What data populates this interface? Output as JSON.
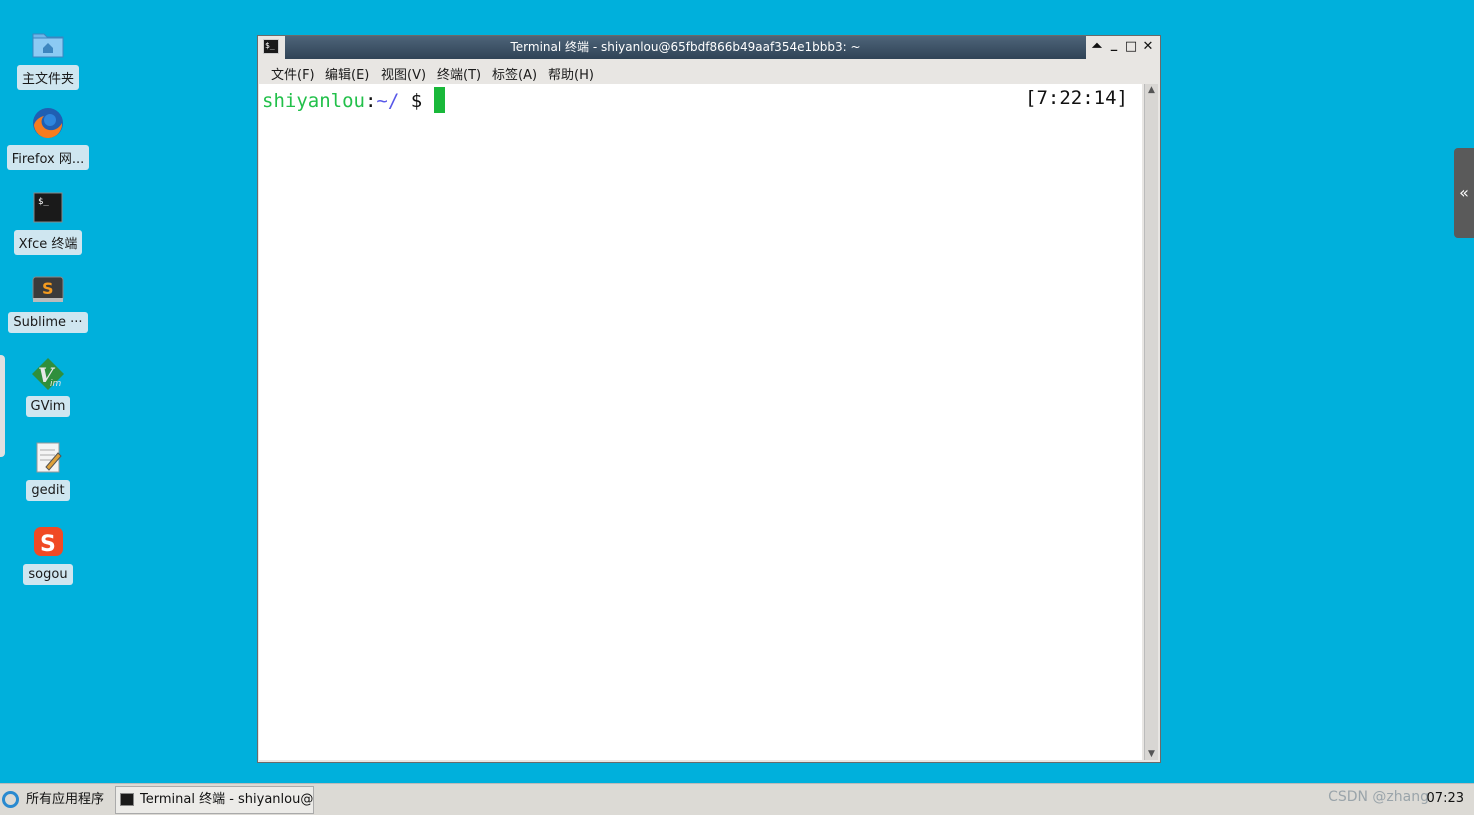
{
  "desktop": {
    "icons": [
      {
        "label": "主文件夹",
        "icon": "home-folder-icon"
      },
      {
        "label": "Firefox 网...",
        "icon": "firefox-icon"
      },
      {
        "label": "Xfce 终端",
        "icon": "terminal-icon"
      },
      {
        "label": "Sublime ···",
        "icon": "sublime-icon"
      },
      {
        "label": "GVim",
        "icon": "gvim-icon"
      },
      {
        "label": "gedit",
        "icon": "gedit-icon"
      },
      {
        "label": "sogou",
        "icon": "sogou-icon"
      }
    ]
  },
  "window": {
    "title": "Terminal 终端 - shiyanlou@65fbdf866b49aaf354e1bbb3: ~",
    "app_icon_text": "$_",
    "buttons": {
      "shade": "⏶",
      "minimize": "_",
      "maximize": "□",
      "close": "✕"
    },
    "menu": [
      {
        "label": "文件(F)"
      },
      {
        "label": "编辑(E)"
      },
      {
        "label": "视图(V)"
      },
      {
        "label": "终端(T)"
      },
      {
        "label": "标签(A)"
      },
      {
        "label": "帮助(H)"
      }
    ]
  },
  "terminal": {
    "user": "shiyanlou",
    "colon": ":",
    "path": "~/",
    "dollar": " $ ",
    "clock": "[7:22:14]"
  },
  "side_handle_glyph": "«",
  "taskbar": {
    "apps_menu_label": "所有应用程序",
    "task_label": "Terminal 终端 - shiyanlou@···",
    "watermark": "CSDN @zhang",
    "clock": "07:23"
  },
  "colors": {
    "desktop": "#00b0dc",
    "prompt_user": "#22c04a",
    "prompt_path": "#5858e8",
    "cursor": "#19b83a"
  }
}
